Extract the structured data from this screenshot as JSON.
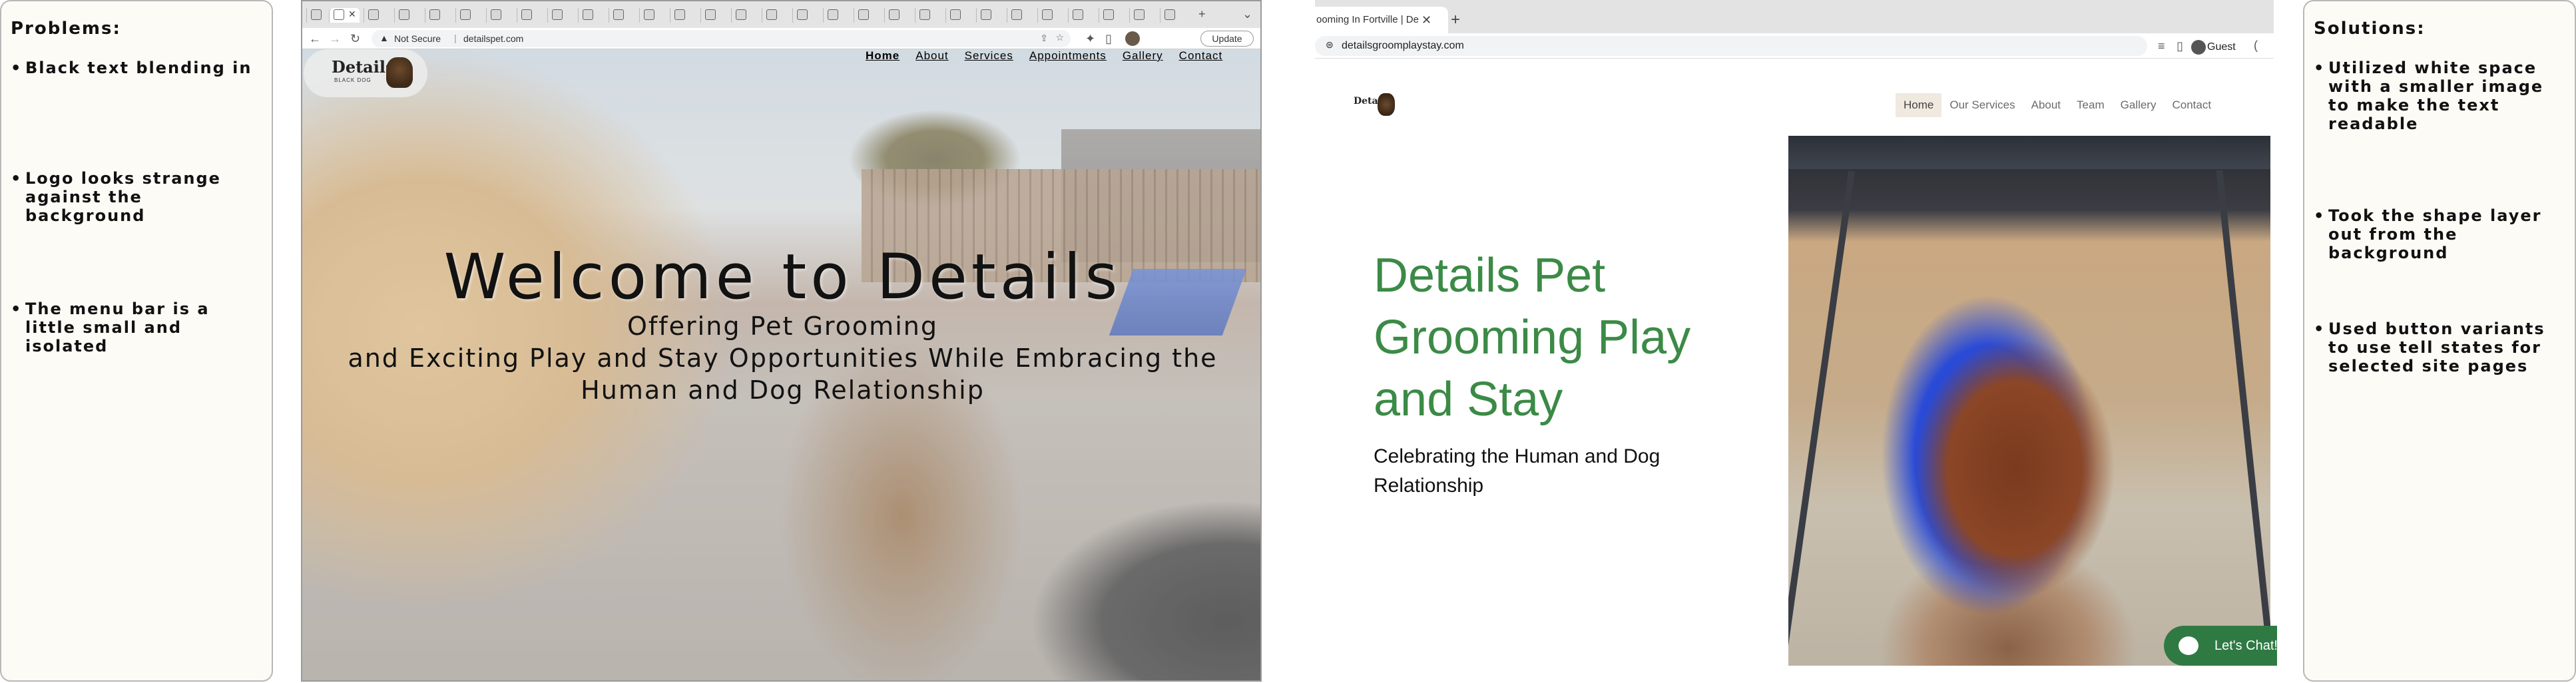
{
  "problems": {
    "title": "Problems:",
    "items": [
      "Black text blending in",
      "Logo looks strange against the background",
      "The menu bar is a little small and isolated"
    ]
  },
  "solutions": {
    "title": "Solutions:",
    "items": [
      "Utilized white space with a smaller image to make the text readable",
      "Took the shape layer out from the background",
      "Used button variants to use tell states for selected site pages"
    ]
  },
  "old_site": {
    "address": {
      "security": "Not Secure",
      "url": "detailspet.com"
    },
    "update_label": "Update",
    "nav": [
      "Home",
      "About",
      "Services",
      "Appointments",
      "Gallery",
      "Contact"
    ],
    "active_nav": "Home",
    "hero": {
      "title": "Welcome to Details",
      "line1": "Offering Pet Grooming",
      "line2": "and Exciting Play and Stay Opportunities While Embracing the Human and Dog Relationship"
    }
  },
  "new_site": {
    "tab_title": "ooming In Fortville | De",
    "url": "detailsgroomplaystay.com",
    "profile_label": "Guest",
    "nav": [
      "Home",
      "Our Services",
      "About",
      "Team",
      "Gallery",
      "Contact"
    ],
    "active_nav": "Home",
    "headline": "Details Pet Grooming Play and Stay",
    "subheadline": "Celebrating the Human and Dog Relationship",
    "chat_label": "Let's Chat!"
  },
  "colors": {
    "accent_green": "#3b8a46",
    "chat_green": "#2f7a43",
    "panel_bg": "#fcfbf6"
  }
}
